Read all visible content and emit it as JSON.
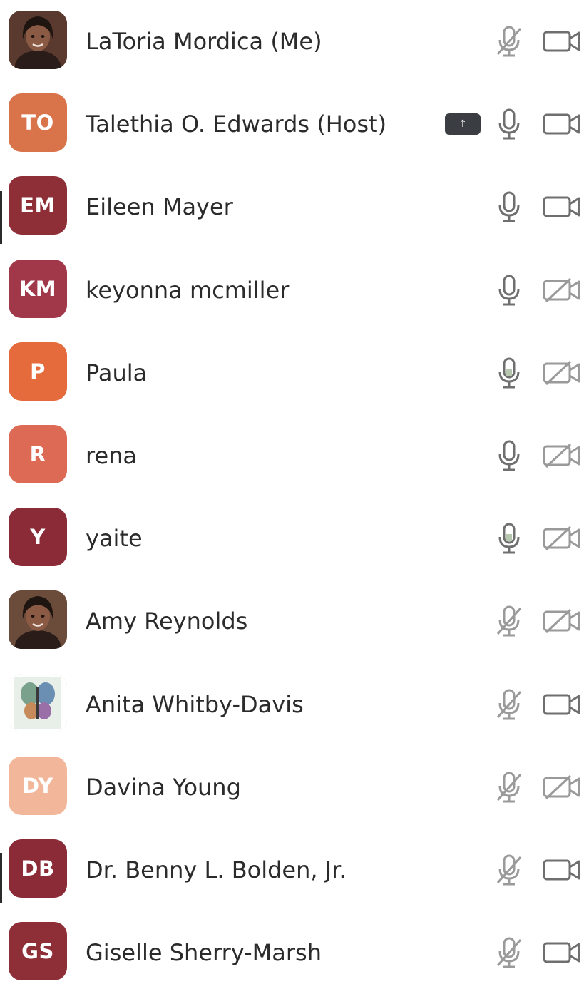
{
  "participants": [
    {
      "name": "LaToria Mordica (Me)",
      "avatar": {
        "type": "photo",
        "name": "woman-photo-icon",
        "color": "#5a3a2e"
      },
      "mic": "muted",
      "video": "on"
    },
    {
      "name": "Talethia O. Edwards  (Host)",
      "avatar": {
        "type": "initials",
        "initials": "TO",
        "color": "#d9734a"
      },
      "mic": "on",
      "video": "on",
      "badge": {
        "icon": "raised-hand-icon",
        "glyph": "↑"
      }
    },
    {
      "name": "Eileen Mayer",
      "avatar": {
        "type": "initials",
        "initials": "EM",
        "color": "#8e2f37"
      },
      "mic": "on",
      "video": "on"
    },
    {
      "name": "keyonna mcmiller",
      "avatar": {
        "type": "initials",
        "initials": "KM",
        "color": "#a0384a"
      },
      "mic": "on",
      "video": "off"
    },
    {
      "name": "Paula",
      "avatar": {
        "type": "initials",
        "initials": "P",
        "color": "#e56a3c"
      },
      "mic": "speaking",
      "video": "off"
    },
    {
      "name": "rena",
      "avatar": {
        "type": "initials",
        "initials": "R",
        "color": "#dd6a55"
      },
      "mic": "on",
      "video": "off"
    },
    {
      "name": "yaite",
      "avatar": {
        "type": "initials",
        "initials": "Y",
        "color": "#8a2b37"
      },
      "mic": "speaking",
      "video": "off"
    },
    {
      "name": "Amy Reynolds",
      "avatar": {
        "type": "photo",
        "name": "woman-photo-icon",
        "color": "#6b4b3a"
      },
      "mic": "muted",
      "video": "off"
    },
    {
      "name": "Anita Whitby-Davis",
      "avatar": {
        "type": "photo",
        "name": "butterfly-photo-icon",
        "color": "#9bb6a8"
      },
      "mic": "muted",
      "video": "on"
    },
    {
      "name": "Davina Young",
      "avatar": {
        "type": "initials",
        "initials": "DY",
        "color": "#f2b79a"
      },
      "mic": "muted",
      "video": "off"
    },
    {
      "name": "Dr. Benny L. Bolden, Jr.",
      "avatar": {
        "type": "initials",
        "initials": "DB",
        "color": "#8a2b37"
      },
      "mic": "muted",
      "video": "on"
    },
    {
      "name": "Giselle Sherry-Marsh",
      "avatar": {
        "type": "initials",
        "initials": "GS",
        "color": "#8e2f37"
      },
      "mic": "muted",
      "video": "on"
    }
  ],
  "icon_names": {
    "mic_on": "microphone-icon",
    "mic_muted": "microphone-muted-icon",
    "mic_speaking": "microphone-speaking-icon",
    "video_on": "video-camera-icon",
    "video_off": "video-camera-off-icon"
  },
  "colors": {
    "text": "#2b2b2b",
    "icon_dark": "#6f6f6f",
    "icon_light": "#9a9a9a"
  }
}
